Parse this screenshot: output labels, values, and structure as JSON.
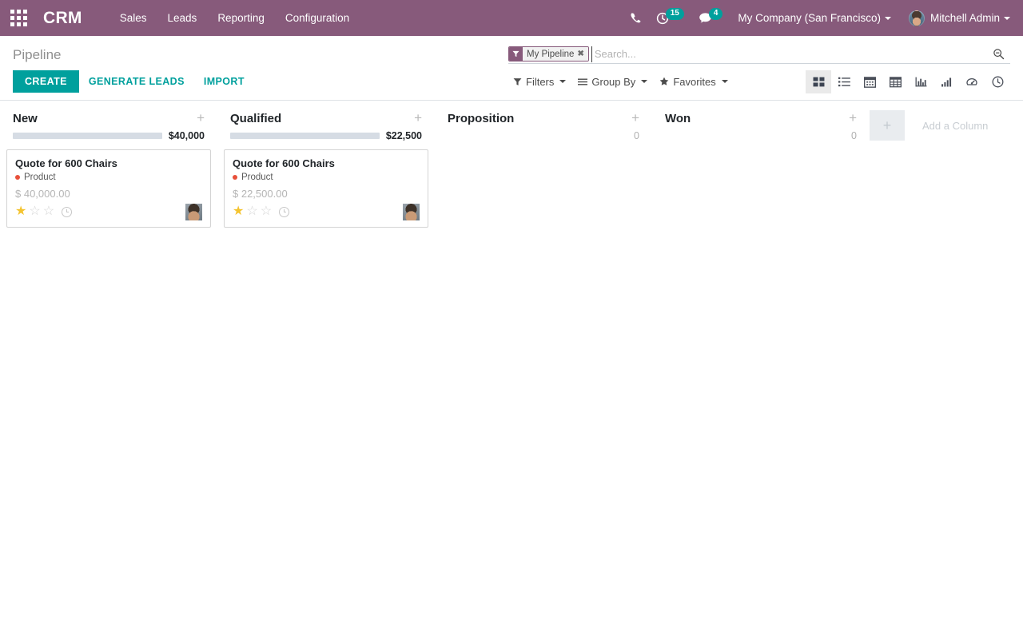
{
  "navbar": {
    "apps_icon": "apps-grid-icon",
    "brand": "CRM",
    "menu": [
      {
        "label": "Sales"
      },
      {
        "label": "Leads"
      },
      {
        "label": "Reporting"
      },
      {
        "label": "Configuration"
      }
    ],
    "phone_icon": "phone-icon",
    "activity_icon": "clock-activity-icon",
    "activity_count": "15",
    "messaging_icon": "chat-bubble-icon",
    "messaging_count": "4",
    "company": "My Company (San Francisco)",
    "user": "Mitchell Admin",
    "colors": {
      "navbar_bg": "#875A7B",
      "badge_bg": "#00A09D"
    }
  },
  "control_panel": {
    "breadcrumb": "Pipeline",
    "search": {
      "facet_icon": "filter-funnel-icon",
      "facet_label": "My Pipeline",
      "facet_close": "✖",
      "placeholder": "Search...",
      "value": "",
      "search_icon": "magnifier-icon"
    },
    "buttons": {
      "create": "CREATE",
      "generate_leads": "GENERATE LEADS",
      "import": "IMPORT"
    },
    "dropdowns": [
      {
        "label": "Filters",
        "icon": "filter-funnel-icon"
      },
      {
        "label": "Group By",
        "icon": "hamburger-lines-icon"
      },
      {
        "label": "Favorites",
        "icon": "star-icon"
      }
    ],
    "views": [
      {
        "name": "kanban",
        "icon": "kanban-icon",
        "active": true
      },
      {
        "name": "list",
        "icon": "list-icon",
        "active": false
      },
      {
        "name": "calendar",
        "icon": "calendar-icon",
        "active": false
      },
      {
        "name": "pivot",
        "icon": "pivot-table-icon",
        "active": false
      },
      {
        "name": "graph",
        "icon": "bar-chart-icon",
        "active": false
      },
      {
        "name": "forecast",
        "icon": "ascending-bars-icon",
        "active": false
      },
      {
        "name": "cohort",
        "icon": "dashboard-gauge-icon",
        "active": false
      },
      {
        "name": "activity",
        "icon": "clock-icon",
        "active": false
      }
    ]
  },
  "kanban": {
    "columns": [
      {
        "title": "New",
        "amount": "$40,000",
        "bar_percent": 100,
        "has_bar": true,
        "plus_icon": "plus-icon",
        "cards": [
          {
            "title": "Quote for 600 Chairs",
            "tag": "Product",
            "tag_color": "#E8503A",
            "amount": "$ 40,000.00",
            "stars_filled": 1,
            "stars_total": 3,
            "clock_icon": "clock-icon",
            "avatar": "user-avatar"
          }
        ]
      },
      {
        "title": "Qualified",
        "amount": "$22,500",
        "bar_percent": 100,
        "has_bar": true,
        "plus_icon": "plus-icon",
        "cards": [
          {
            "title": "Quote for 600 Chairs",
            "tag": "Product",
            "tag_color": "#E8503A",
            "amount": "$ 22,500.00",
            "stars_filled": 1,
            "stars_total": 3,
            "clock_icon": "clock-icon",
            "avatar": "user-avatar"
          }
        ]
      },
      {
        "title": "Proposition",
        "amount": "0",
        "bar_percent": 0,
        "has_bar": false,
        "plus_icon": "plus-icon",
        "cards": []
      },
      {
        "title": "Won",
        "amount": "0",
        "bar_percent": 0,
        "has_bar": false,
        "plus_icon": "plus-icon",
        "cards": []
      }
    ],
    "add_column": {
      "plus_icon": "plus-icon",
      "label": "Add a Column"
    }
  }
}
